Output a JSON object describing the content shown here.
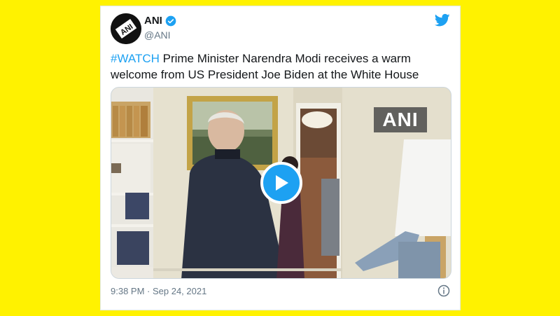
{
  "tweet": {
    "author_name": "ANI",
    "author_handle": "@ANI",
    "avatar_text": "ANI",
    "hashtag": "#WATCH",
    "body": " Prime Minister Narendra Modi receives a warm welcome from US President Joe Biden at the White House",
    "timestamp": "9:38 PM · Sep 24, 2021"
  },
  "video": {
    "watermark": "ANI",
    "play_icon": "play-icon"
  },
  "colors": {
    "background": "#FFF200",
    "accent": "#1DA1F2",
    "text": "#14171A",
    "muted": "#657786"
  },
  "icons": [
    "verified-icon",
    "twitter-bird-icon",
    "play-icon",
    "info-icon"
  ]
}
